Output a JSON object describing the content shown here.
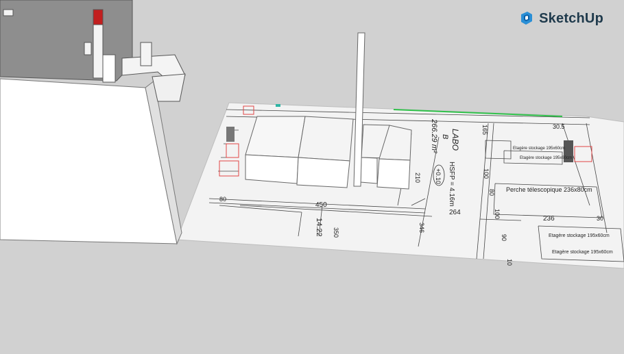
{
  "brand": {
    "name": "SketchUp",
    "icon": "sketchup-logo-icon",
    "color": "#1f3a4c",
    "accent": "#2a8fd6"
  },
  "scene": {
    "background": "#d1d1d1",
    "room_name": "LABO",
    "room_id": "B",
    "room_area": "266.29 m²",
    "hsfp": "HSFP = 4.16m",
    "level": "+0.10",
    "dimensions": [
      "450",
      "350",
      "264",
      "236",
      "210",
      "346",
      "80",
      "14.22",
      "100",
      "90",
      "80",
      "100",
      "165",
      "30",
      "10",
      "30.5"
    ],
    "shelves": [
      "Etagère stockage 195x60cm",
      "Etagère stockage 195x60cm",
      "Perche télescopique 236x80cm",
      "Etagère stockage 195x60cm",
      "Etagère stockage 195x60cm"
    ]
  }
}
